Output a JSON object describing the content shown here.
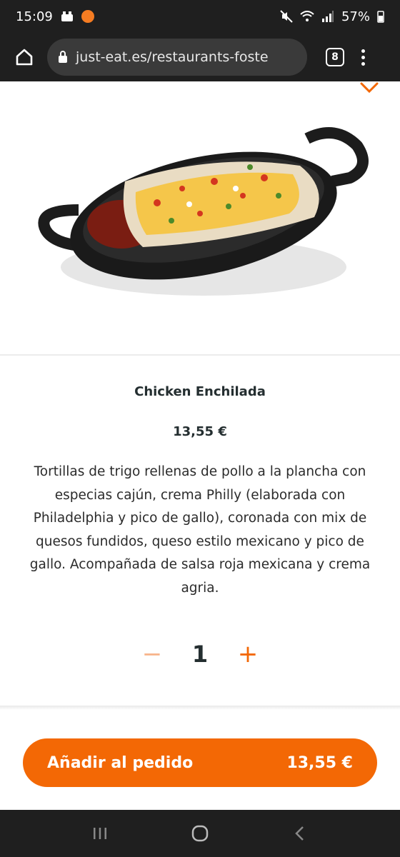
{
  "status_bar": {
    "time": "15:09",
    "battery": "57%"
  },
  "browser": {
    "url": "just-eat.es/restaurants-foste",
    "tab_count": "8"
  },
  "product": {
    "title": "Chicken Enchilada",
    "price": "13,55 €",
    "description": "Tortillas de trigo rellenas de pollo a la plancha con especias cajún, crema Philly (elaborada con Philadelphia y pico de gallo), coronada con mix de quesos fundidos, queso estilo mexicano y pico de gallo. Acompañada de  salsa roja mexicana y crema agria."
  },
  "quantity": {
    "minus": "−",
    "value": "1",
    "plus": "+"
  },
  "cta": {
    "label": "Añadir al pedido",
    "price": "13,55 €"
  },
  "colors": {
    "accent": "#f36805",
    "dark_bar": "#1f1f1f"
  },
  "icons": [
    "close-icon",
    "home-icon",
    "lock-icon",
    "tabs-icon",
    "more-icon",
    "recent-apps-icon",
    "home-nav-icon",
    "back-icon"
  ]
}
